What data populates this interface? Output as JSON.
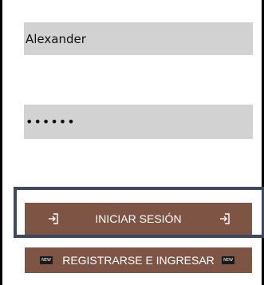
{
  "login_form": {
    "username_value": "Alexander",
    "password_value": "••••••",
    "login_button_label": "INICIAR SESIÓN",
    "register_button_label": "REGISTRARSE E INGRESAR",
    "new_badge_text": "NEW"
  },
  "icons": {
    "login_icon": "sign-in-icon",
    "new_icon": "new-badge-icon"
  },
  "colors": {
    "button_bg": "#7e5444",
    "field_bg": "#d2d2d2",
    "highlight_border": "#3a4a5c"
  }
}
